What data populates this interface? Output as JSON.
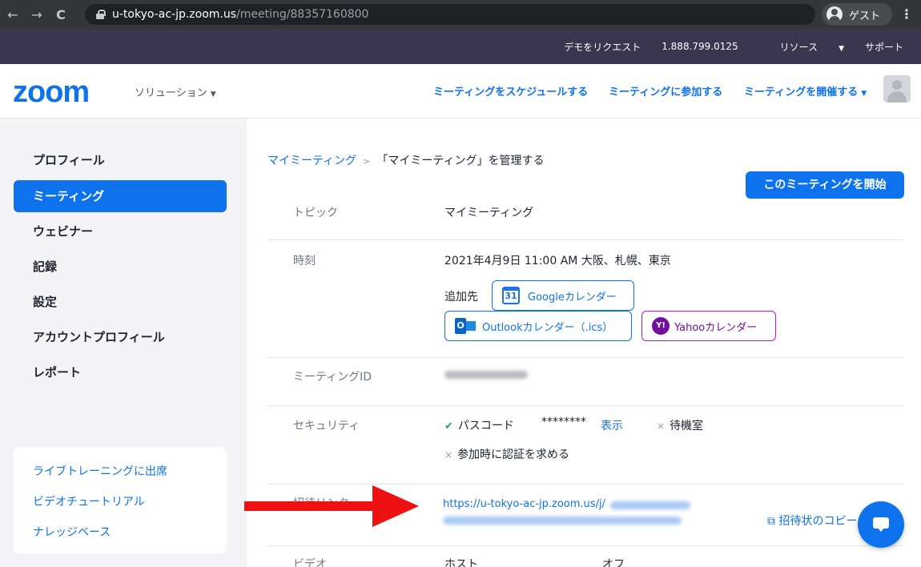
{
  "browser": {
    "back_icon": "←",
    "forward_icon": "→",
    "reload_icon": "C",
    "url_host": "u-tokyo-ac-jp.zoom.us",
    "url_path": "/meeting/88357160800",
    "guest_label": "ゲスト",
    "menu_icon": "⋮"
  },
  "util_bar": {
    "demo_request": "デモをリクエスト",
    "phone": "1.888.799.0125",
    "resources": "リソース",
    "support": "サポート"
  },
  "header": {
    "logo": "zoom",
    "solutions": "ソリューション",
    "schedule": "ミーティングをスケジュールする",
    "join": "ミーティングに参加する",
    "host": "ミーティングを開催する"
  },
  "sidebar": {
    "items": [
      {
        "label": "プロフィール",
        "active": false
      },
      {
        "label": "ミーティング",
        "active": true
      },
      {
        "label": "ウェビナー",
        "active": false
      },
      {
        "label": "記録",
        "active": false
      },
      {
        "label": "設定",
        "active": false
      },
      {
        "label": "アカウントプロフィール",
        "active": false
      },
      {
        "label": "レポート",
        "active": false
      }
    ],
    "help_links": [
      "ライブトレーニングに出席",
      "ビデオチュートリアル",
      "ナレッジベース"
    ]
  },
  "main": {
    "breadcrumb_link": "マイミーティング",
    "breadcrumb_sep": ">",
    "breadcrumb_current": "「マイミーティング」を管理する",
    "start_button": "このミーティングを開始",
    "topic_label": "トピック",
    "topic_value": "マイミーティング",
    "time_label": "時刻",
    "time_value": "2021年4月9日 11:00 AM 大阪、札幌、東京",
    "add_to_label": "追加先",
    "google_cal": "Googleカレンダー",
    "google_icon_text": "31",
    "outlook_cal": "Outlookカレンダー（.ics）",
    "outlook_icon_text": "O",
    "yahoo_cal": "Yahooカレンダー",
    "yahoo_icon_text": "Y!",
    "meeting_id_label": "ミーティングID",
    "security_label": "セキュリティ",
    "passcode_label": "パスコード",
    "passcode_mask": "********",
    "show_link": "表示",
    "waiting_room": "待機室",
    "auth_required": "参加時に認証を求める",
    "invite_label": "招待リンク",
    "invite_url_prefix": "https://u-tokyo-ac-jp.zoom.us/j/",
    "copy_invite": "招待状のコピー",
    "video_label": "ビデオ",
    "host_label": "ホスト",
    "off_label": "オフ",
    "check_icon": "✔",
    "x_icon": "×",
    "copy_icon": "⧉"
  },
  "colors": {
    "accent": "#0e72ed",
    "arrow": "#ee1111",
    "utility_bar": "#3a3650"
  }
}
